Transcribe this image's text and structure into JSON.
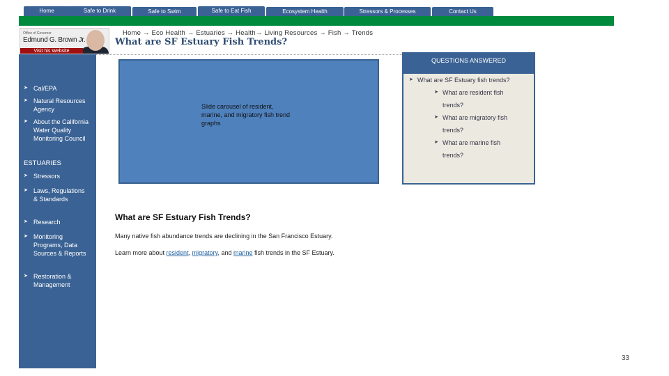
{
  "nav": {
    "tabs": [
      "Home",
      "Safe to Drink",
      "Safe to Swim",
      "Safe to Eat Fish",
      "Ecosystem Health",
      "Stressors & Processes",
      "Contact Us"
    ]
  },
  "banner": {
    "office": "Office of Governor",
    "name": "Edmund G. Brown Jr.",
    "link": "Visit his Website"
  },
  "breadcrumb": "Home → Eco Health → Estuaries → Health→ Living Resources → Fish → Trends",
  "page_title": "What are SF Estuary Fish Trends?",
  "sidebar": {
    "items": [
      "Cal/EPA",
      "Natural Resources Agency",
      "About the California Water Quality Monitoring Council"
    ],
    "section": "ESTUARIES",
    "section_items": [
      "Stressors",
      "Laws, Regulations & Standards",
      "Research",
      "Monitoring Programs, Data Sources & Reports",
      "Restoration & Management"
    ]
  },
  "carousel": {
    "text": "Slide carousel of resident, marine, and migratory fish trend graphs"
  },
  "questions": {
    "header": "QUESTIONS ANSWERED",
    "main": "What are SF Estuary fish trends?",
    "sub": [
      "What are resident fish trends?",
      "What are migratory fish trends?",
      "What are marine fish trends?"
    ]
  },
  "content": {
    "heading": "What are SF Estuary Fish Trends?",
    "para1": "Many native fish abundance  trends are declining in the San Francisco Estuary.",
    "para2_pre": "Learn more about ",
    "link_resident": "resident",
    "sep1": ", ",
    "link_migratory": "migratory",
    "sep2": ", and ",
    "link_marine": "marine",
    "para2_post": " fish trends in the SF Estuary."
  },
  "page_number": "33"
}
